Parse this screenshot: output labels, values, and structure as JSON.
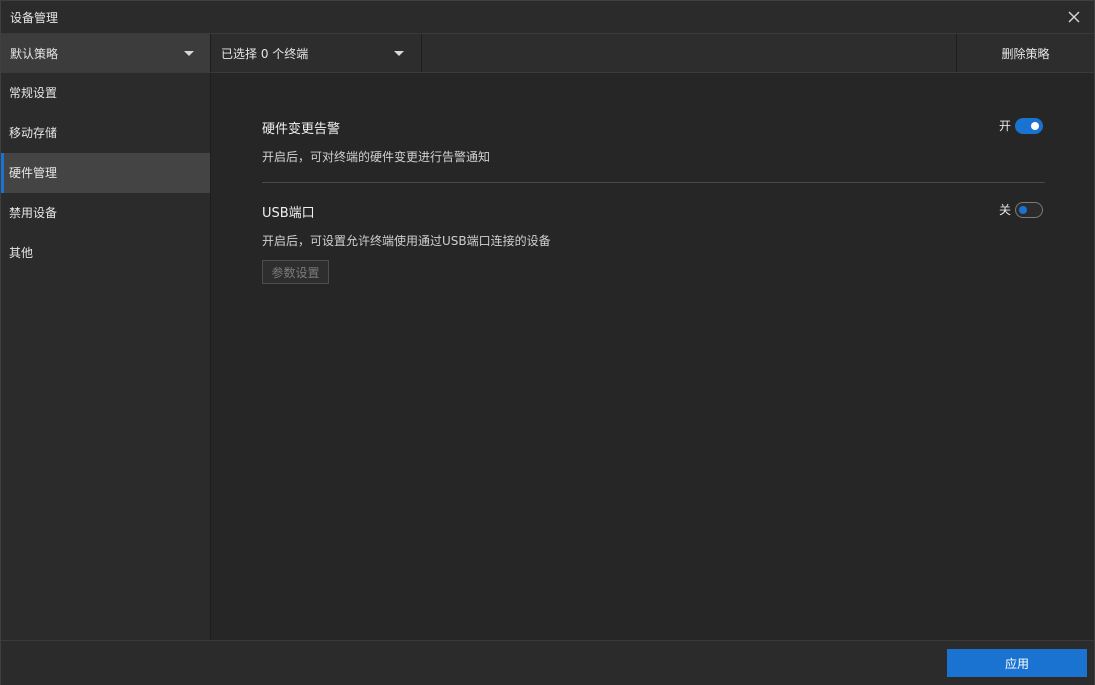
{
  "window": {
    "title": "设备管理"
  },
  "toolbar": {
    "policy_select": "默认策略",
    "terminal_select": "已选择 0 个终端",
    "delete_policy": "删除策略"
  },
  "sidebar": {
    "items": [
      {
        "label": "常规设置",
        "active": false
      },
      {
        "label": "移动存储",
        "active": false
      },
      {
        "label": "硬件管理",
        "active": true
      },
      {
        "label": "禁用设备",
        "active": false
      },
      {
        "label": "其他",
        "active": false
      }
    ]
  },
  "settings": [
    {
      "name": "硬件变更告警",
      "description": "开启后，可对终端的硬件变更进行告警通知",
      "toggle_label": "开",
      "enabled": true
    },
    {
      "name": "USB端口",
      "description": "开启后，可设置允许终端使用通过USB端口连接的设备",
      "toggle_label": "关",
      "enabled": false,
      "button_label": "参数设置"
    }
  ],
  "footer": {
    "apply_label": "应用"
  },
  "colors": {
    "accent": "#1a73d1",
    "background": "#262626",
    "sidebar_active": "#444444"
  },
  "icons": {
    "close": "close-icon",
    "dropdown": "caret-down-icon"
  }
}
